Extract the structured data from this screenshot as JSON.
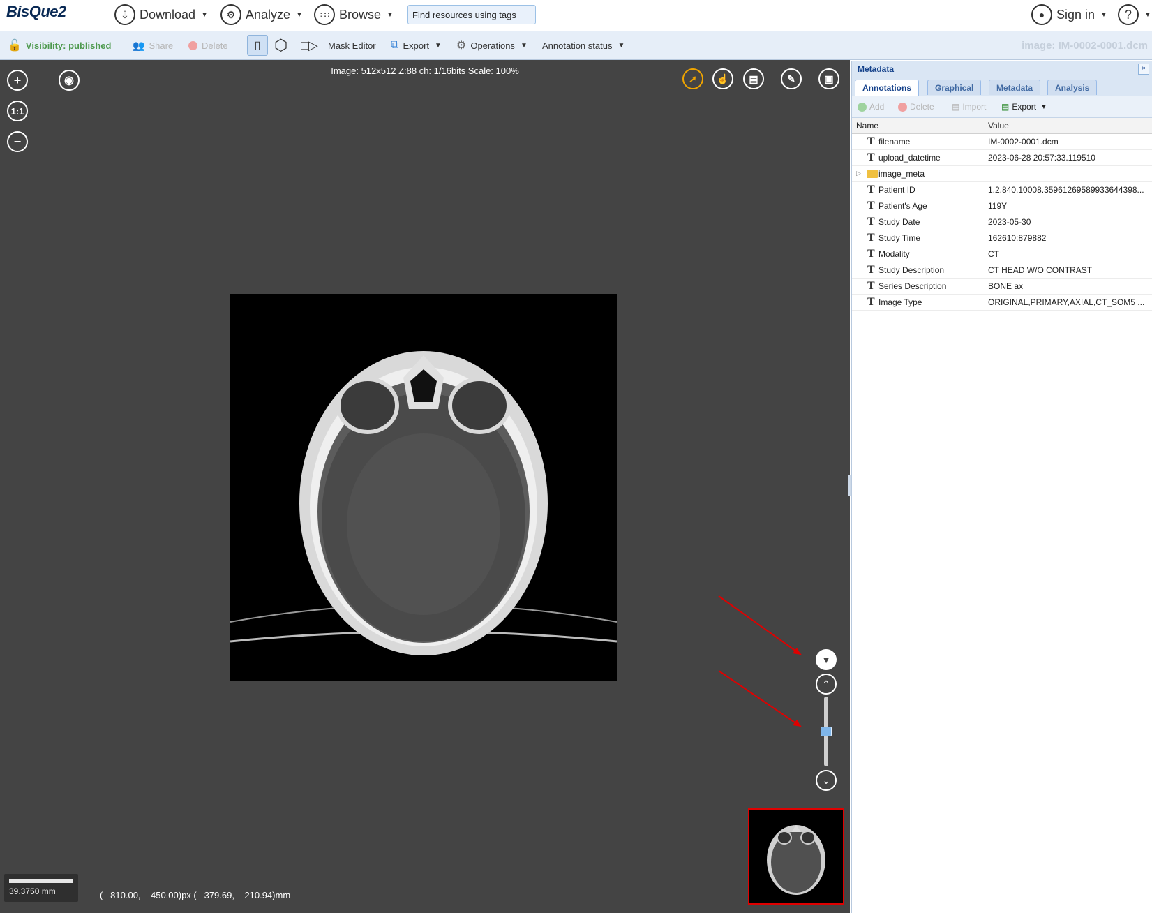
{
  "app": {
    "logo": "BisQue2",
    "menus": {
      "download": "Download",
      "analyze": "Analyze",
      "browse": "Browse",
      "sign_in": "Sign in",
      "help": "?"
    },
    "search_placeholder": "Find resources using tags"
  },
  "toolbar": {
    "visibility": "Visibility: published",
    "share": "Share",
    "delete": "Delete",
    "mask_editor": "Mask Editor",
    "export": "Export",
    "operations": "Operations",
    "annotation_status": "Annotation status",
    "image_title": "image: IM-0002-0001.dcm"
  },
  "viewer": {
    "image_info": "Image: 512x512 Z:88 ch: 1/16bits Scale: 100%",
    "zoom_reset_label": "1:1",
    "scale_label": "39.3750 mm",
    "coords": "(   810.00,    450.00)px (   379.69,    210.94)mm",
    "slice_position_fraction": 0.5
  },
  "panel": {
    "title": "Metadata",
    "tabs": [
      "Annotations",
      "Graphical",
      "Metadata",
      "Analysis"
    ],
    "active_tab": "Annotations",
    "toolbar": {
      "add": "Add",
      "delete": "Delete",
      "import": "Import",
      "export": "Export"
    },
    "columns": {
      "name": "Name",
      "value": "Value"
    },
    "rows": [
      {
        "type": "text",
        "name": "filename",
        "value": "IM-0002-0001.dcm"
      },
      {
        "type": "text",
        "name": "upload_datetime",
        "value": "2023-06-28 20:57:33.119510"
      },
      {
        "type": "folder",
        "name": "image_meta",
        "value": ""
      },
      {
        "type": "text",
        "name": "Patient ID",
        "value": "1.2.840.10008.35961269589933644398..."
      },
      {
        "type": "text",
        "name": "Patient's Age",
        "value": "119Y"
      },
      {
        "type": "text",
        "name": "Study Date",
        "value": "2023-05-30"
      },
      {
        "type": "text",
        "name": "Study Time",
        "value": "162610:879882"
      },
      {
        "type": "text",
        "name": "Modality",
        "value": "CT"
      },
      {
        "type": "text",
        "name": "Study Description",
        "value": "CT HEAD W/O CONTRAST"
      },
      {
        "type": "text",
        "name": "Series Description",
        "value": "BONE ax"
      },
      {
        "type": "text",
        "name": "Image Type",
        "value": "ORIGINAL,PRIMARY,AXIAL,CT_SOM5 ..."
      }
    ]
  },
  "colors": {
    "viewer_bg": "#444444",
    "toolbar_bg": "#e6eef8",
    "visibility_green": "#4f9a4f",
    "annotation_arrow_red": "#e00000",
    "overview_border": "#e00000",
    "active_tool_orange": "#f0a500"
  }
}
